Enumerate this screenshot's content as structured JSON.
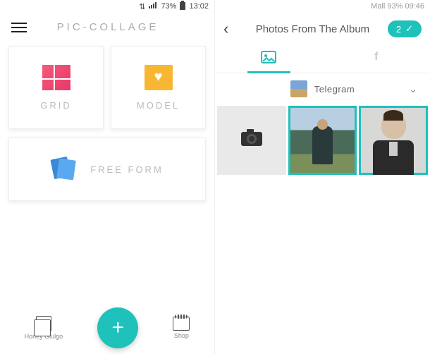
{
  "left": {
    "status": {
      "battery_pct": "73%",
      "time": "13:02"
    },
    "app_title": "PIC-COLLAGE",
    "cards": {
      "grid": "GRID",
      "model": "MODEL",
      "freeform": "FREE FORM"
    },
    "nav": {
      "left_label": "Honey Giulgo",
      "right_label": "Shop"
    }
  },
  "right": {
    "status": {
      "text": "Mall 93% 09:46"
    },
    "title": "Photos From The Album",
    "selected_count": "2",
    "album": {
      "name": "Telegram"
    }
  }
}
